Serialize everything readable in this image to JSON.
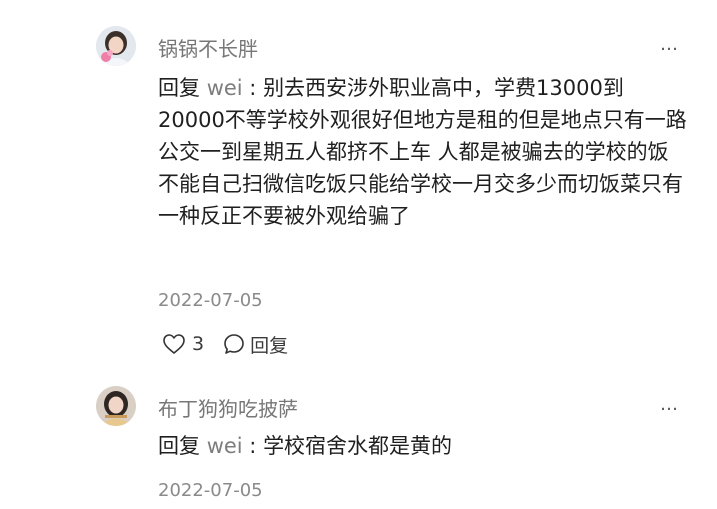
{
  "comments": [
    {
      "username": "锅锅不长胖",
      "reply_prefix": "回复 ",
      "reply_target": "wei",
      "reply_separator": " : ",
      "text": "别去西安涉外职业高中，学费13000到20000不等学校外观很好但地方是租的但是地点只有一路公交一到星期五人都挤不上车 人都是被骗去的学校的饭不能自己扫微信吃饭只能给学校一月交多少而切饭菜只有一种反正不要被外观给骗了",
      "date": "2022-07-05",
      "likes": "3",
      "reply_label": "回复",
      "more_icon": "…"
    },
    {
      "username": "布丁狗狗吃披萨",
      "reply_prefix": "回复 ",
      "reply_target": "wei",
      "reply_separator": " : ",
      "text": "学校宿舍水都是黄的",
      "date": "2022-07-05",
      "more_icon": "…"
    }
  ]
}
